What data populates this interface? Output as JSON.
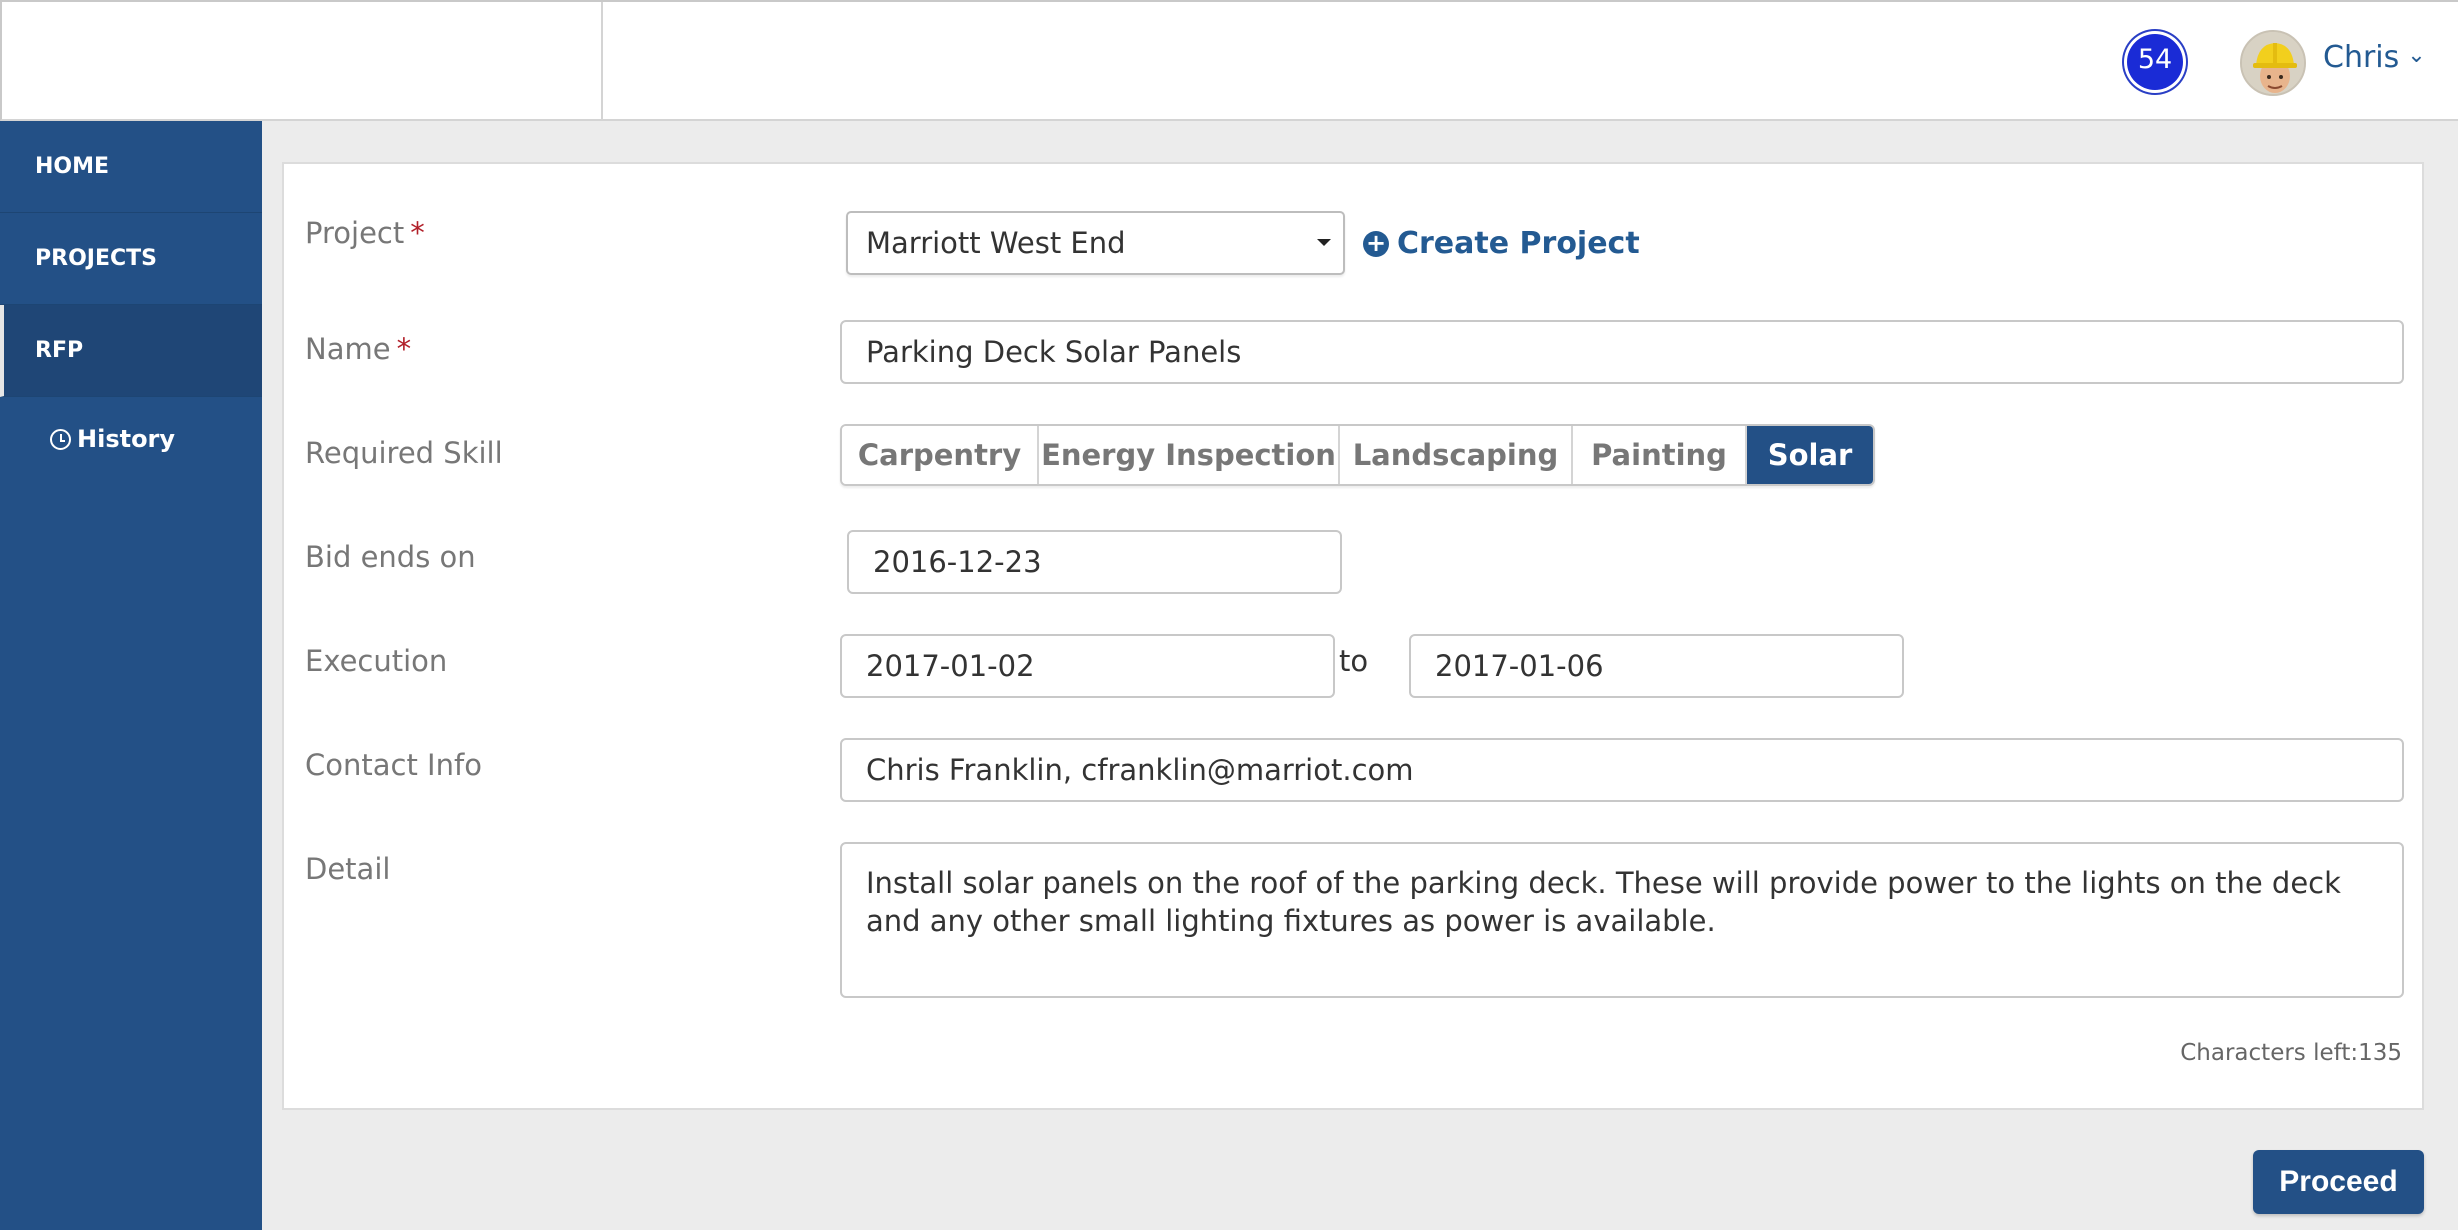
{
  "header": {
    "notification_count": "54",
    "user_name": "Chris"
  },
  "sidebar": {
    "items": [
      {
        "label": "HOME"
      },
      {
        "label": "PROJECTS"
      },
      {
        "label": "RFP"
      }
    ],
    "sub_items": [
      {
        "label": "History"
      }
    ]
  },
  "form": {
    "project": {
      "label": "Project",
      "required_mark": "*",
      "value": "Marriott West End",
      "create_label": "Create Project"
    },
    "name": {
      "label": "Name",
      "required_mark": "*",
      "value": "Parking Deck Solar Panels"
    },
    "skill": {
      "label": "Required Skill",
      "options": [
        "Carpentry",
        "Energy Inspection",
        "Landscaping",
        "Painting",
        "Solar"
      ],
      "selected": "Solar"
    },
    "bid_ends": {
      "label": "Bid ends on",
      "value": "2016-12-23"
    },
    "execution": {
      "label": "Execution",
      "start": "2017-01-02",
      "to_word": "to",
      "end": "2017-01-06"
    },
    "contact": {
      "label": "Contact Info",
      "value": "Chris Franklin, cfranklin@marriot.com"
    },
    "detail": {
      "label": "Detail",
      "value": "Install solar panels on the roof of the parking deck. These will provide power to the lights on the deck and any other small lighting fixtures as power is available."
    },
    "chars_left": "Characters left:135"
  },
  "actions": {
    "proceed_label": "Proceed"
  },
  "colors": {
    "brand": "#235086",
    "link": "#235a92",
    "badge": "#1a2bd6",
    "required": "#b2202a"
  }
}
